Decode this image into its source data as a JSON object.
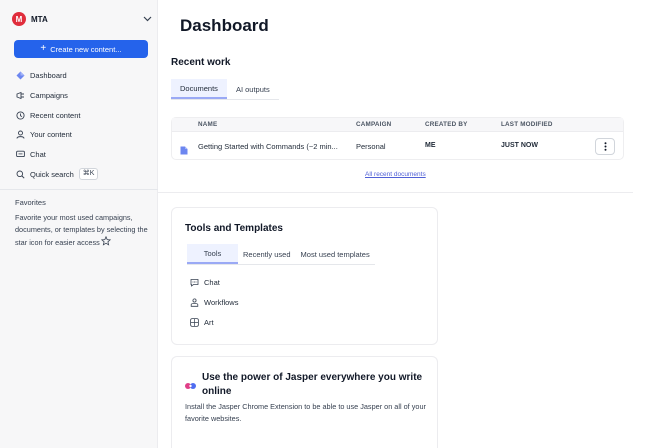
{
  "workspace": {
    "logo_letter": "M",
    "name": "MTA"
  },
  "sidebar": {
    "create_button": "Create new content...",
    "items": [
      {
        "label": "Dashboard",
        "icon": "dashboard-icon"
      },
      {
        "label": "Campaigns",
        "icon": "campaigns-icon"
      },
      {
        "label": "Recent content",
        "icon": "recent-icon"
      },
      {
        "label": "Your content",
        "icon": "user-icon"
      },
      {
        "label": "Chat",
        "icon": "chat-icon"
      },
      {
        "label": "Quick search",
        "icon": "search-icon",
        "shortcut": "⌘K"
      }
    ],
    "favorites_title": "Favorites",
    "favorites_desc": "Favorite your most used campaigns, documents, or templates by selecting the star icon for easier access"
  },
  "main": {
    "title": "Dashboard",
    "recent": {
      "title": "Recent work",
      "tabs": [
        "Documents",
        "AI outputs"
      ],
      "columns": [
        "NAME",
        "CAMPAIGN",
        "CREATED BY",
        "LAST MODIFIED"
      ],
      "rows": [
        {
          "name": "Getting Started with Commands (~2 min...",
          "campaign": "Personal",
          "created_by": "ME",
          "modified": "JUST NOW"
        }
      ],
      "all_link": "All recent documents"
    },
    "tools": {
      "title": "Tools and Templates",
      "tabs": [
        "Tools",
        "Recently used",
        "Most used templates"
      ],
      "items": [
        {
          "label": "Chat",
          "icon": "chat-icon"
        },
        {
          "label": "Workflows",
          "icon": "workflows-icon"
        },
        {
          "label": "Art",
          "icon": "art-icon"
        }
      ]
    },
    "promo": {
      "title": "Use the power of Jasper everywhere you write online",
      "desc": "Install the Jasper Chrome Extension to be able to use Jasper on all of your favorite websites."
    }
  },
  "colors": {
    "primary": "#2563eb",
    "logo": "#e02d3c",
    "tab_active_bg": "#eef2ff",
    "link": "#4f5fd6"
  }
}
